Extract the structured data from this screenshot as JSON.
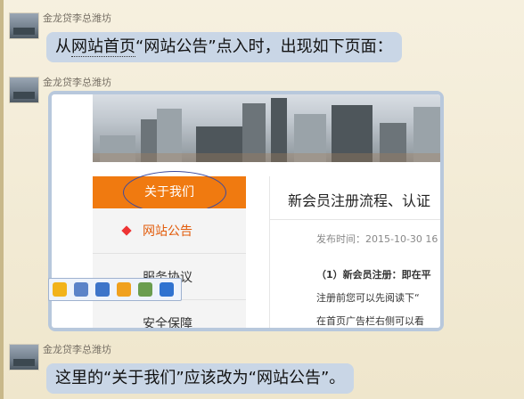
{
  "messages": [
    {
      "sender": "金龙贷李总潍坊",
      "text_pre": "从",
      "text_link": "网站首页",
      "text_post": "“网站公告”点入时，出现如下页面："
    },
    {
      "sender": "金龙贷李总潍坊"
    },
    {
      "sender": "金龙贷李总潍坊",
      "text": "这里的“关于我们”应该改为“网站公告”。"
    }
  ],
  "screenshot": {
    "nav": {
      "about_label": "关于我们",
      "items": [
        {
          "label": "网站公告"
        },
        {
          "label": "服务协议"
        },
        {
          "label": "安全保障"
        }
      ]
    },
    "article": {
      "title": "新会员注册流程、认证",
      "meta": "发布时间：2015-10-30 16",
      "lines": [
        "（1）新会员注册：即在平",
        "注册前您可以先阅读下“",
        "在首页广告栏右侧可以看"
      ]
    }
  },
  "toolbar": {
    "icons": [
      "emoji-icon",
      "save-icon",
      "screen-icon",
      "smile-icon",
      "image-icon",
      "bookmark-icon"
    ],
    "colors": [
      "#f2b31a",
      "#5b83c8",
      "#3d74c9",
      "#f0a11f",
      "#6a9d4f",
      "#2f72d0"
    ]
  },
  "colors": {
    "bubble": "#c9d6e6",
    "nav_active": "#f07a10",
    "annotation_circle": "#3b4aa0"
  }
}
